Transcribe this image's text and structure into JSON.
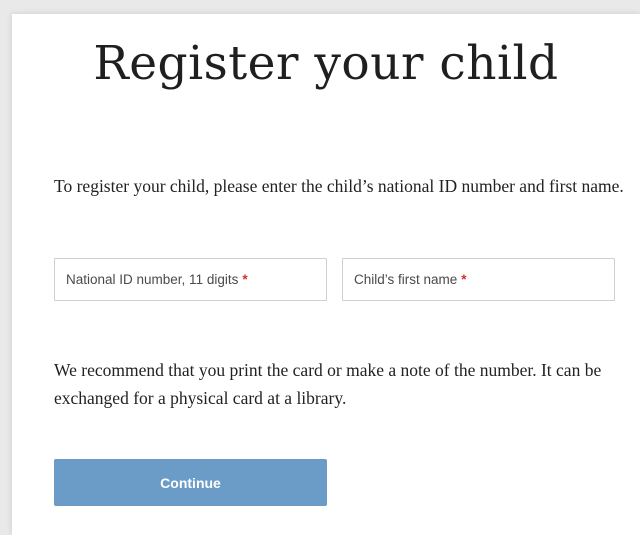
{
  "page": {
    "title": "Register your child",
    "intro": "To register your child, please enter the child’s national ID number and first name.",
    "note": "We recommend that you print the card or make a note of the number. It can be exchanged for a physical card at a library."
  },
  "form": {
    "national_id": {
      "placeholder": "National ID number, 11 digits",
      "required_mark": "*",
      "value": ""
    },
    "first_name": {
      "placeholder": "Child’s first name",
      "required_mark": "*",
      "value": ""
    },
    "continue_label": "Continue"
  },
  "colors": {
    "button": "#6a9cc7",
    "required": "#d0312d",
    "text": "#222222"
  }
}
